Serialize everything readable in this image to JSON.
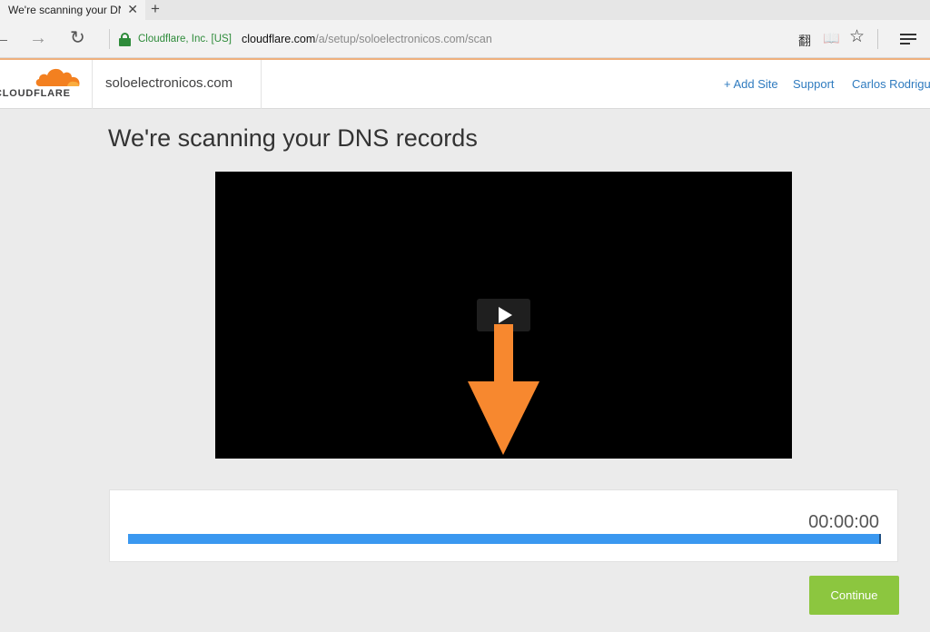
{
  "browser": {
    "tab_title": "We're scanning your DNS records",
    "tab_close": "✕",
    "new_tab": "+",
    "back": "←",
    "forward": "→",
    "refresh": "↻",
    "cert_label": "Cloudflare, Inc. [US]",
    "url_host": "cloudflare.com",
    "url_path": "/a/setup/soloelectronicos.com/scan",
    "icons": {
      "translate": "翻",
      "reading_view": "📖",
      "favorite": "☆"
    }
  },
  "header": {
    "logo_text": "CLOUDFLARE",
    "site_name": "soloelectronicos.com",
    "nav": {
      "add_site": "+ Add Site",
      "support": "Support",
      "user": "Carlos Rodriguez"
    }
  },
  "main": {
    "title": "We're scanning your DNS records",
    "timer": "00:00:00",
    "progress": 1.0,
    "continue_label": "Continue"
  },
  "colors": {
    "cloudflare_orange": "#f38020",
    "progress_blue": "#3a98f0",
    "continue_green": "#8cc63f",
    "link_blue": "#2f7bbf"
  }
}
